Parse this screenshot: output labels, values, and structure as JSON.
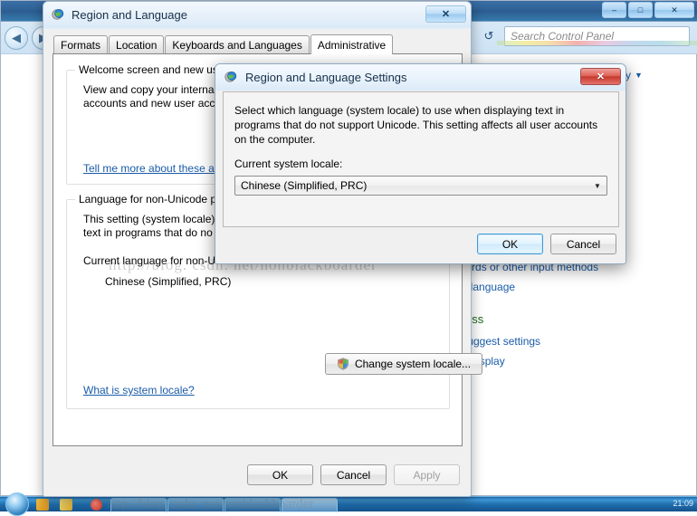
{
  "control_panel": {
    "search": {
      "placeholder": "Search Control Panel",
      "value": ""
    },
    "refresh_icon": "refresh-icon",
    "back_icon": "back-arrow-icon",
    "forward_icon": "forward-arrow-icon",
    "minimize_label": "–",
    "maximize_label": "□",
    "close_label": "✕",
    "view_by": "ry",
    "view_by_caret": "▼",
    "links": [
      "boards or other input methods",
      "lay language"
    ],
    "section_heading": "ccess",
    "links2": [
      "s suggest settings",
      "ual display"
    ]
  },
  "taskbar": {
    "start_label": "start-orb",
    "clock": "21:09",
    "buttons": [
      "task-notepad",
      "task-window",
      "task-window-2",
      "task-control-panel"
    ]
  },
  "outer_dialog": {
    "title": "Region and Language",
    "window_icon": "region-globe-icon",
    "close_label": "✕",
    "tabs": [
      {
        "label": "Formats",
        "selected": false
      },
      {
        "label": "Location",
        "selected": false
      },
      {
        "label": "Keyboards and Languages",
        "selected": false
      },
      {
        "label": "Administrative",
        "selected": true
      }
    ],
    "group_welcome": {
      "title": "Welcome screen and new us",
      "line1": "View and copy your interna",
      "line2": "accounts and new user acc",
      "link": "Tell me more about these a"
    },
    "group_nonunicode": {
      "title": "Language for non-Unicode p",
      "line1": "This setting (system locale)",
      "line2": "text in programs that do no",
      "current_label": "Current language for non-U",
      "current_value": "Chinese (Simplified, PRC)",
      "change_button": "Change system locale...",
      "change_button_icon": "uac-shield-icon",
      "link": "What is system locale?"
    },
    "footer": {
      "ok": "OK",
      "cancel": "Cancel",
      "apply": "Apply",
      "apply_disabled": true
    }
  },
  "inner_dialog": {
    "title": "Region and Language Settings",
    "window_icon": "region-globe-icon",
    "close_label": "✕",
    "description": "Select which language (system locale) to use when displaying text in programs that do not support Unicode. This setting affects all user accounts on the computer.",
    "locale_label": "Current system locale:",
    "locale_value": "Chinese (Simplified, PRC)",
    "locale_caret": "▼",
    "footer": {
      "ok": "OK",
      "cancel": "Cancel"
    }
  },
  "watermark": {
    "line1": "http://blog. csdn. net/nonblackboarder",
    "line2": "http://blog. csdn. net/nonblackboarder"
  },
  "colors": {
    "accent_blue": "#1a5ca8",
    "green_heading": "#1d6b1d",
    "close_red": "#c8392e",
    "default_button_border": "#3c9ad9"
  }
}
